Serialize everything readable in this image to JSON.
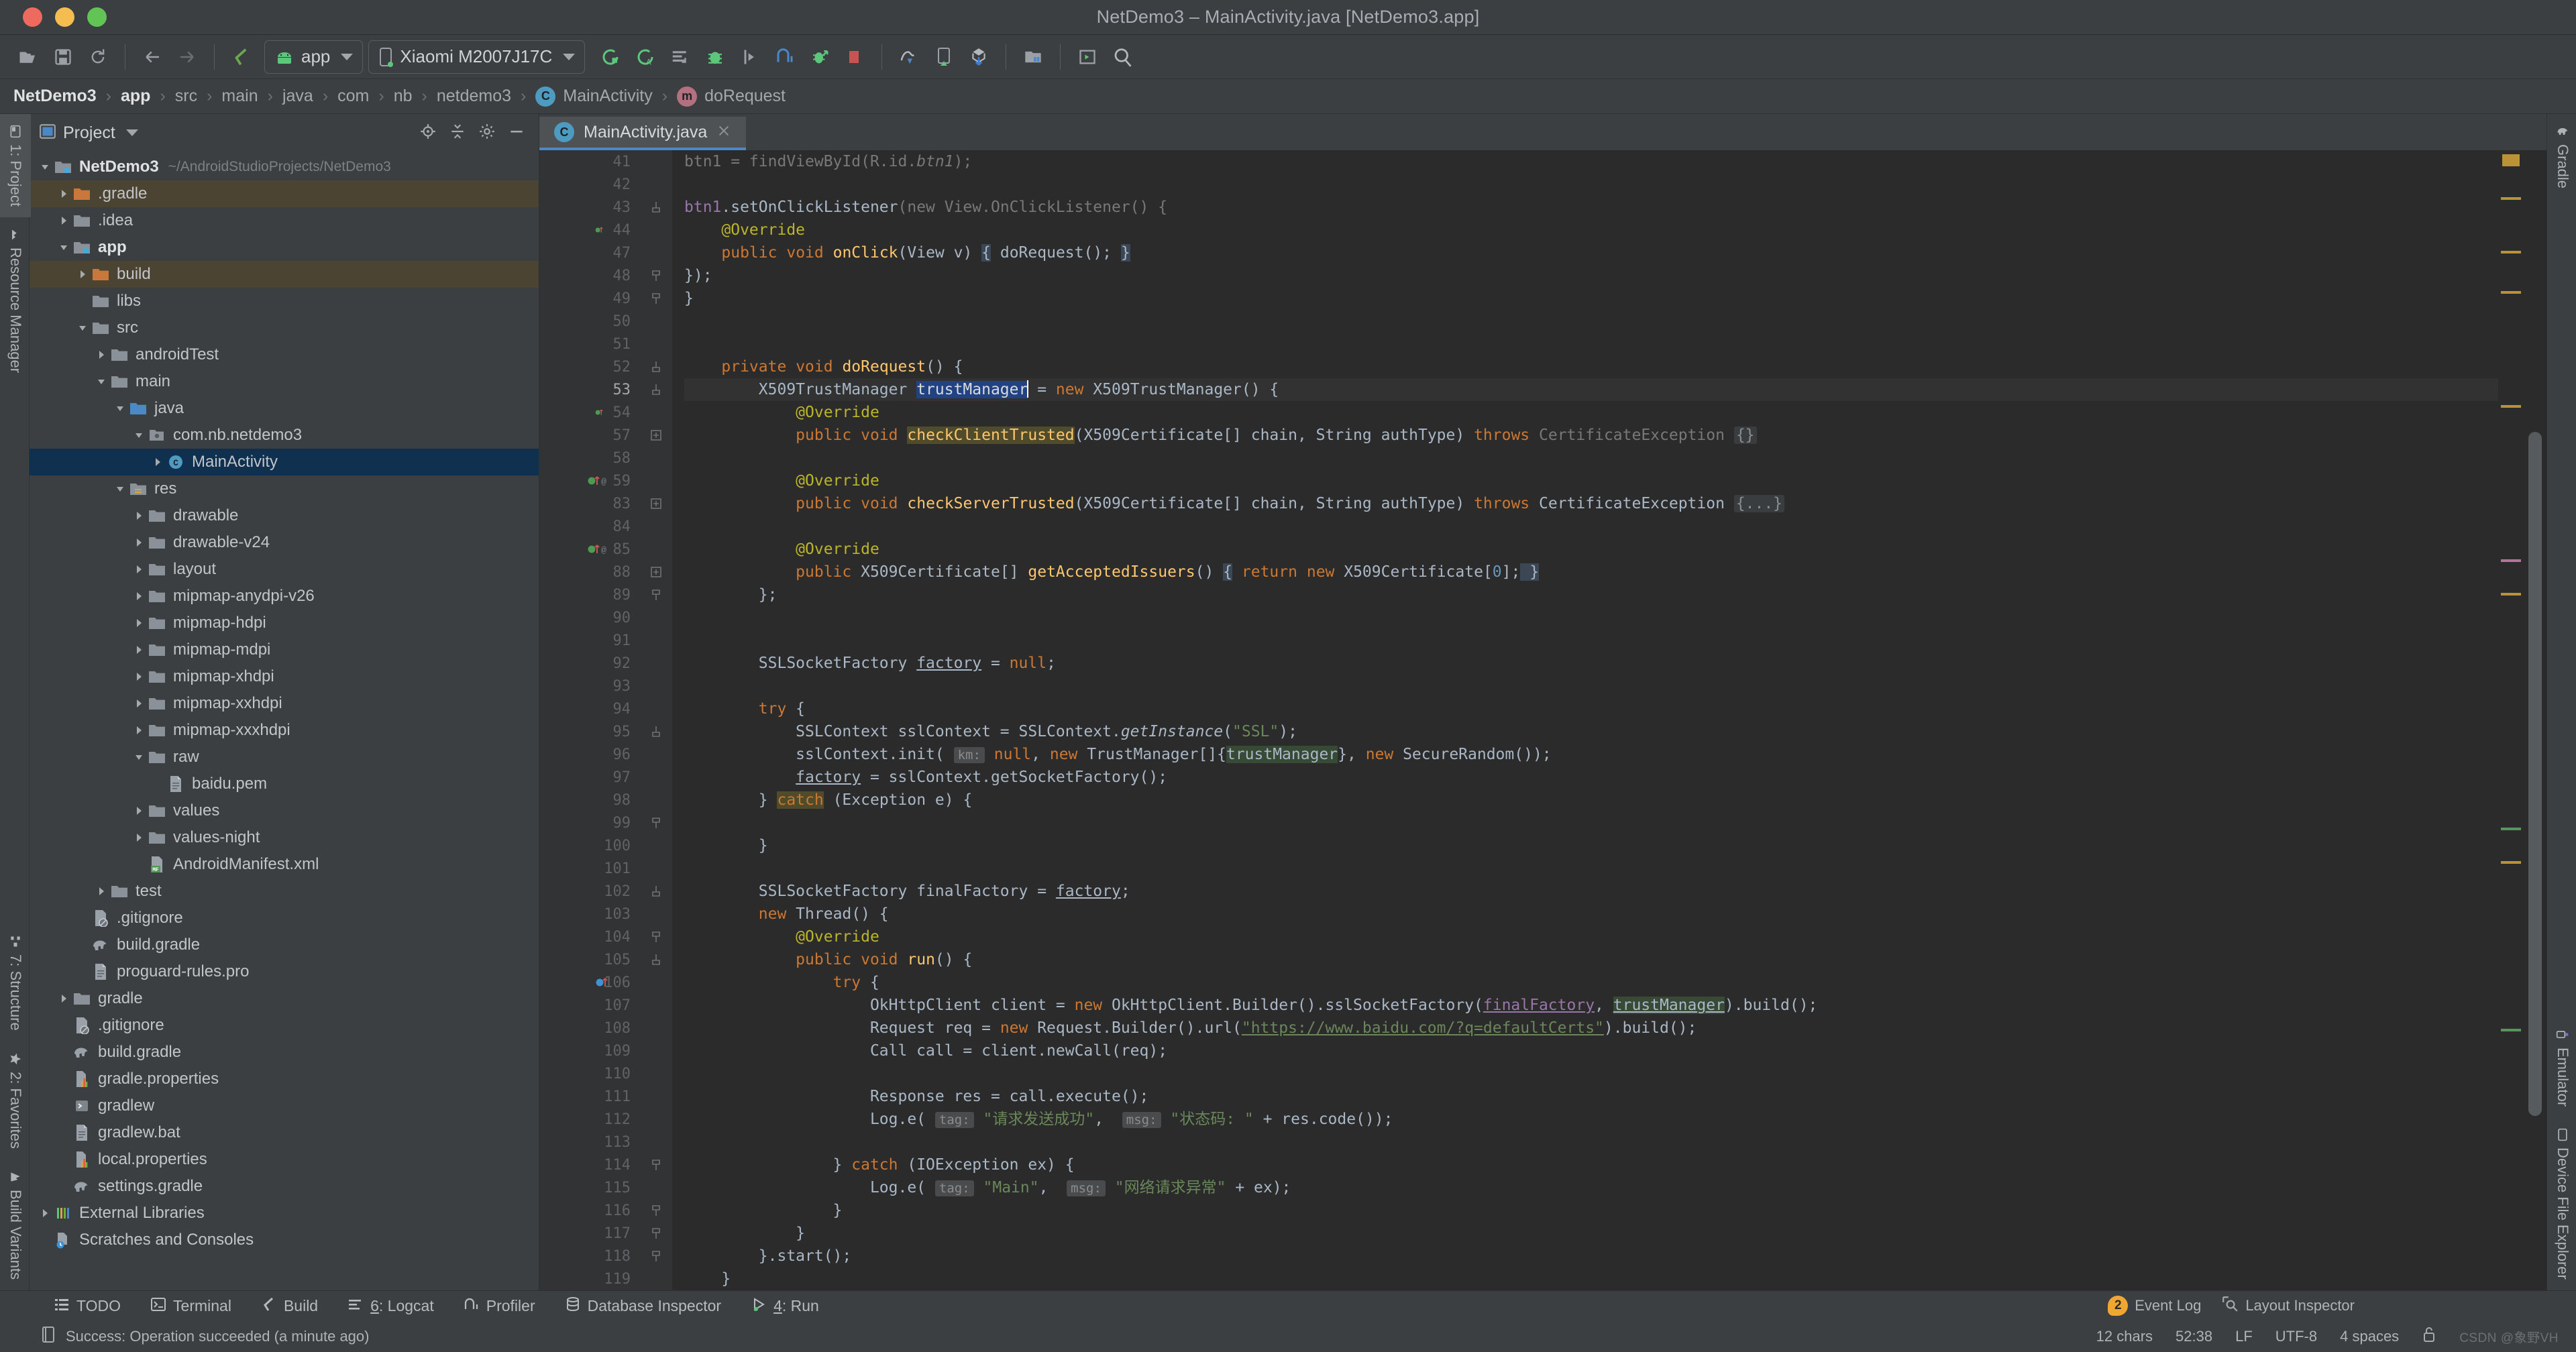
{
  "window": {
    "title": "NetDemo3 – MainActivity.java [NetDemo3.app]",
    "traffic": [
      "close",
      "minimize",
      "zoom"
    ]
  },
  "toolbar": {
    "icons": [
      {
        "name": "open-folder-icon",
        "label": "Open"
      },
      {
        "name": "save-all-icon",
        "label": "Save All"
      },
      {
        "name": "sync-icon",
        "label": "Sync Project with Gradle Files"
      },
      {
        "name": "back-icon",
        "label": "Back"
      },
      {
        "name": "forward-icon",
        "label": "Forward"
      },
      {
        "name": "avd-manager-icon",
        "label": "AVD Manager"
      }
    ],
    "run_config": {
      "label": "app",
      "icon": "android-icon"
    },
    "device": {
      "label": "Xiaomi M2007J17C",
      "icon": "phone-icon"
    },
    "actions": [
      {
        "name": "run-icon",
        "label": "Run 'app'"
      },
      {
        "name": "apply-changes-icon",
        "label": "Apply Changes"
      },
      {
        "name": "logcat-icon",
        "label": "Logcat"
      },
      {
        "name": "debug-icon",
        "label": "Debug 'app'"
      },
      {
        "name": "run-to-cursor-icon",
        "label": "Run to Cursor"
      },
      {
        "name": "profiler-icon",
        "label": "Profile 'app'"
      },
      {
        "name": "attach-debugger-icon",
        "label": "Attach Debugger to Android Process"
      },
      {
        "name": "stop-icon",
        "label": "Stop"
      },
      {
        "name": "sdk-manager-icon",
        "label": "SDK Manager"
      },
      {
        "name": "device-manager-icon",
        "label": "Device Manager"
      },
      {
        "name": "gradle-sync-icon",
        "label": "Sync"
      },
      {
        "name": "project-structure-icon",
        "label": "Project Structure"
      },
      {
        "name": "layout-editor-icon",
        "label": "Layout Editor"
      },
      {
        "name": "search-everywhere-icon",
        "label": "Search Everywhere"
      }
    ]
  },
  "breadcrumb": [
    {
      "label": "NetDemo3",
      "badge": null,
      "bold": true
    },
    {
      "label": "app",
      "badge": null,
      "bold": true
    },
    {
      "label": "src",
      "badge": null,
      "bold": false
    },
    {
      "label": "main",
      "badge": null,
      "bold": false
    },
    {
      "label": "java",
      "badge": null,
      "bold": false
    },
    {
      "label": "com",
      "badge": null,
      "bold": false
    },
    {
      "label": "nb",
      "badge": null,
      "bold": false
    },
    {
      "label": "netdemo3",
      "badge": null,
      "bold": false
    },
    {
      "label": "MainActivity",
      "badge": "C",
      "bold": false
    },
    {
      "label": "doRequest",
      "badge": "m",
      "bold": false
    }
  ],
  "left_rail": {
    "top": [
      {
        "label": "1: Project",
        "icon": "project-icon",
        "selected": true
      },
      {
        "label": "Resource Manager",
        "icon": "resource-manager-icon",
        "selected": false
      }
    ],
    "bottom": [
      {
        "label": "7: Structure",
        "icon": "structure-icon",
        "selected": false
      },
      {
        "label": "2: Favorites",
        "icon": "star-icon",
        "selected": false
      },
      {
        "label": "Build Variants",
        "icon": "build-variants-icon",
        "selected": false
      }
    ]
  },
  "right_rail": {
    "top": [
      {
        "label": "Gradle",
        "icon": "gradle-elephant-icon"
      }
    ],
    "bottom": [
      {
        "label": "Emulator",
        "icon": "emulator-icon"
      },
      {
        "label": "Device File Explorer",
        "icon": "device-file-explorer-icon"
      }
    ]
  },
  "project_panel": {
    "title": "Project",
    "tools": [
      {
        "name": "locate-file-icon"
      },
      {
        "name": "collapse-all-icon"
      },
      {
        "name": "settings-gear-icon"
      },
      {
        "name": "hide-panel-icon"
      }
    ],
    "tree": [
      {
        "indent": 0,
        "tw": "open",
        "icon": "module-folder-icon",
        "name": "NetDemo3",
        "sub": "~/AndroidStudioProjects/NetDemo3",
        "bold": true,
        "state": "none"
      },
      {
        "indent": 1,
        "tw": "closed",
        "icon": "folder-orange-icon",
        "name": ".gradle",
        "sub": "",
        "bold": false,
        "state": "hl"
      },
      {
        "indent": 1,
        "tw": "closed",
        "icon": "folder-icon",
        "name": ".idea",
        "sub": "",
        "bold": false,
        "state": "none"
      },
      {
        "indent": 1,
        "tw": "open",
        "icon": "module-folder-icon",
        "name": "app",
        "sub": "",
        "bold": true,
        "state": "none"
      },
      {
        "indent": 2,
        "tw": "closed",
        "icon": "folder-orange-icon",
        "name": "build",
        "sub": "",
        "bold": false,
        "state": "hl"
      },
      {
        "indent": 2,
        "tw": "none",
        "icon": "folder-icon",
        "name": "libs",
        "sub": "",
        "bold": false,
        "state": "none"
      },
      {
        "indent": 2,
        "tw": "open",
        "icon": "folder-icon",
        "name": "src",
        "sub": "",
        "bold": false,
        "state": "none"
      },
      {
        "indent": 3,
        "tw": "closed",
        "icon": "folder-icon",
        "name": "androidTest",
        "sub": "",
        "bold": false,
        "state": "none"
      },
      {
        "indent": 3,
        "tw": "open",
        "icon": "folder-icon",
        "name": "main",
        "sub": "",
        "bold": false,
        "state": "none"
      },
      {
        "indent": 4,
        "tw": "open",
        "icon": "folder-blue-icon",
        "name": "java",
        "sub": "",
        "bold": false,
        "state": "none"
      },
      {
        "indent": 5,
        "tw": "open",
        "icon": "package-icon",
        "name": "com.nb.netdemo3",
        "sub": "",
        "bold": false,
        "state": "none"
      },
      {
        "indent": 6,
        "tw": "closed",
        "icon": "class-icon",
        "name": "MainActivity",
        "sub": "",
        "bold": false,
        "state": "sel"
      },
      {
        "indent": 4,
        "tw": "open",
        "icon": "res-folder-icon",
        "name": "res",
        "sub": "",
        "bold": false,
        "state": "none"
      },
      {
        "indent": 5,
        "tw": "closed",
        "icon": "folder-icon",
        "name": "drawable",
        "sub": "",
        "bold": false,
        "state": "none"
      },
      {
        "indent": 5,
        "tw": "closed",
        "icon": "folder-icon",
        "name": "drawable-v24",
        "sub": "",
        "bold": false,
        "state": "none"
      },
      {
        "indent": 5,
        "tw": "closed",
        "icon": "folder-icon",
        "name": "layout",
        "sub": "",
        "bold": false,
        "state": "none"
      },
      {
        "indent": 5,
        "tw": "closed",
        "icon": "folder-icon",
        "name": "mipmap-anydpi-v26",
        "sub": "",
        "bold": false,
        "state": "none"
      },
      {
        "indent": 5,
        "tw": "closed",
        "icon": "folder-icon",
        "name": "mipmap-hdpi",
        "sub": "",
        "bold": false,
        "state": "none"
      },
      {
        "indent": 5,
        "tw": "closed",
        "icon": "folder-icon",
        "name": "mipmap-mdpi",
        "sub": "",
        "bold": false,
        "state": "none"
      },
      {
        "indent": 5,
        "tw": "closed",
        "icon": "folder-icon",
        "name": "mipmap-xhdpi",
        "sub": "",
        "bold": false,
        "state": "none"
      },
      {
        "indent": 5,
        "tw": "closed",
        "icon": "folder-icon",
        "name": "mipmap-xxhdpi",
        "sub": "",
        "bold": false,
        "state": "none"
      },
      {
        "indent": 5,
        "tw": "closed",
        "icon": "folder-icon",
        "name": "mipmap-xxxhdpi",
        "sub": "",
        "bold": false,
        "state": "none"
      },
      {
        "indent": 5,
        "tw": "open",
        "icon": "folder-icon",
        "name": "raw",
        "sub": "",
        "bold": false,
        "state": "none"
      },
      {
        "indent": 6,
        "tw": "none",
        "icon": "file-icon",
        "name": "baidu.pem",
        "sub": "",
        "bold": false,
        "state": "none"
      },
      {
        "indent": 5,
        "tw": "closed",
        "icon": "folder-icon",
        "name": "values",
        "sub": "",
        "bold": false,
        "state": "none"
      },
      {
        "indent": 5,
        "tw": "closed",
        "icon": "folder-icon",
        "name": "values-night",
        "sub": "",
        "bold": false,
        "state": "none"
      },
      {
        "indent": 5,
        "tw": "none",
        "icon": "manifest-icon",
        "name": "AndroidManifest.xml",
        "sub": "",
        "bold": false,
        "state": "none"
      },
      {
        "indent": 3,
        "tw": "closed",
        "icon": "folder-icon",
        "name": "test",
        "sub": "",
        "bold": false,
        "state": "none"
      },
      {
        "indent": 2,
        "tw": "none",
        "icon": "gitignore-icon",
        "name": ".gitignore",
        "sub": "",
        "bold": false,
        "state": "none"
      },
      {
        "indent": 2,
        "tw": "none",
        "icon": "gradle-file-icon",
        "name": "build.gradle",
        "sub": "",
        "bold": false,
        "state": "none"
      },
      {
        "indent": 2,
        "tw": "none",
        "icon": "file-icon",
        "name": "proguard-rules.pro",
        "sub": "",
        "bold": false,
        "state": "none"
      },
      {
        "indent": 1,
        "tw": "closed",
        "icon": "folder-icon",
        "name": "gradle",
        "sub": "",
        "bold": false,
        "state": "none"
      },
      {
        "indent": 1,
        "tw": "none",
        "icon": "gitignore-icon",
        "name": ".gitignore",
        "sub": "",
        "bold": false,
        "state": "none"
      },
      {
        "indent": 1,
        "tw": "none",
        "icon": "gradle-file-icon",
        "name": "build.gradle",
        "sub": "",
        "bold": false,
        "state": "none"
      },
      {
        "indent": 1,
        "tw": "none",
        "icon": "properties-icon",
        "name": "gradle.properties",
        "sub": "",
        "bold": false,
        "state": "none"
      },
      {
        "indent": 1,
        "tw": "none",
        "icon": "shell-icon",
        "name": "gradlew",
        "sub": "",
        "bold": false,
        "state": "none"
      },
      {
        "indent": 1,
        "tw": "none",
        "icon": "file-icon",
        "name": "gradlew.bat",
        "sub": "",
        "bold": false,
        "state": "none"
      },
      {
        "indent": 1,
        "tw": "none",
        "icon": "properties-icon",
        "name": "local.properties",
        "sub": "",
        "bold": false,
        "state": "none"
      },
      {
        "indent": 1,
        "tw": "none",
        "icon": "gradle-file-icon",
        "name": "settings.gradle",
        "sub": "",
        "bold": false,
        "state": "none"
      },
      {
        "indent": 0,
        "tw": "closed",
        "icon": "external-libraries-icon",
        "name": "External Libraries",
        "sub": "",
        "bold": false,
        "state": "none"
      },
      {
        "indent": 0,
        "tw": "none",
        "icon": "scratches-icon",
        "name": "Scratches and Consoles",
        "sub": "",
        "bold": false,
        "state": "none"
      }
    ]
  },
  "editor": {
    "tab": {
      "label": "MainActivity.java",
      "badge": "C",
      "close": "×"
    },
    "line_numbers": [
      41,
      42,
      43,
      44,
      47,
      48,
      49,
      50,
      51,
      52,
      53,
      54,
      57,
      58,
      59,
      83,
      84,
      85,
      88,
      89,
      90,
      91,
      92,
      93,
      94,
      95,
      96,
      97,
      98,
      99,
      100,
      101,
      102,
      103,
      104,
      105,
      106,
      107,
      108,
      109,
      110,
      111,
      112,
      113,
      114,
      115,
      116,
      117,
      118,
      119
    ],
    "current_line_index": 9,
    "gutter_marks": [
      {
        "index": 3,
        "type": "override"
      },
      {
        "index": 11,
        "type": "override"
      },
      {
        "index": 14,
        "type": "override-at"
      },
      {
        "index": 17,
        "type": "override-at"
      },
      {
        "index": 36,
        "type": "impl"
      }
    ],
    "code_lines": [
      "btn1 = findViewById(R.id.btn1);",
      "",
      "btn1.setOnClickListener(new View.OnClickListener() {",
      "    @Override",
      "    public void onClick(View v) { doRequest(); }",
      "});",
      "}",
      "",
      "",
      "private void doRequest() {",
      "    X509TrustManager trustManager = new X509TrustManager() {",
      "        @Override",
      "        public void checkClientTrusted(X509Certificate[] chain, String authType) throws CertificateException {}",
      "",
      "        @Override",
      "        public void checkServerTrusted(X509Certificate[] chain, String authType) throws CertificateException {...}",
      "",
      "        @Override",
      "        public X509Certificate[] getAcceptedIssuers() { return new X509Certificate[0]; }",
      "    };",
      "",
      "",
      "    SSLSocketFactory factory = null;",
      "",
      "    try {",
      "        SSLContext sslContext = SSLContext.getInstance(\"SSL\");",
      "        sslContext.init( km: null, new TrustManager[]{trustManager}, new SecureRandom());",
      "        factory = sslContext.getSocketFactory();",
      "    } catch (Exception e) {",
      "",
      "    }",
      "",
      "    SSLSocketFactory finalFactory = factory;",
      "    new Thread() {",
      "        @Override",
      "        public void run() {",
      "            try {",
      "                OkHttpClient client = new OkHttpClient.Builder().sslSocketFactory(finalFactory, trustManager).build();",
      "                Request req = new Request.Builder().url(\"https://www.baidu.com/?q=defaultCerts\").build();",
      "                Call call = client.newCall(req);",
      "",
      "                Response res = call.execute();",
      "                Log.e( tag: \"请求发送成功\",  msg: \"状态码: \" + res.code());",
      "",
      "            } catch (IOException ex) {",
      "                Log.e( tag: \"Main\",  msg: \"网络请求异常\" + ex);",
      "            }",
      "        }",
      "    }.start();",
      "}",
      "}"
    ],
    "selected_token": "trustManager",
    "marker_colors": {
      "warning": "#bb9235",
      "error": "#c75450",
      "info": "#57965c",
      "hint": "#b5739b"
    }
  },
  "tool_windows": [
    {
      "label": "TODO",
      "icon": "todo-icon",
      "accel": ""
    },
    {
      "label": "Terminal",
      "icon": "terminal-icon",
      "accel": ""
    },
    {
      "label": "Build",
      "icon": "build-hammer-icon",
      "accel": ""
    },
    {
      "label": "6: Logcat",
      "icon": "logcat-icon",
      "accel": "6"
    },
    {
      "label": "Profiler",
      "icon": "profiler-icon",
      "accel": ""
    },
    {
      "label": "Database Inspector",
      "icon": "database-icon",
      "accel": ""
    },
    {
      "label": "4: Run",
      "icon": "run-triangle-icon",
      "accel": "4"
    }
  ],
  "status_bar": {
    "message": "Success: Operation succeeded (a minute ago)",
    "message_icon": "build-status-icon",
    "event_log": {
      "label": "Event Log",
      "badge": "2"
    },
    "layout_inspector": {
      "label": "Layout Inspector",
      "icon": "layout-inspector-icon"
    },
    "chars": "12 chars",
    "caret": "52:38",
    "line_sep": "LF",
    "encoding": "UTF-8",
    "indent": "4 spaces",
    "lock_icon": "unlocked-icon",
    "watermark": "CSDN @象野VH"
  },
  "colors": {
    "bg_chrome": "#3c3f41",
    "bg_editor": "#2b2b2b",
    "bg_gutter": "#313335",
    "accent_blue": "#4a88c7",
    "selection": "#214283",
    "tree_selection": "#10304f",
    "android_green": "#3ddc84"
  }
}
